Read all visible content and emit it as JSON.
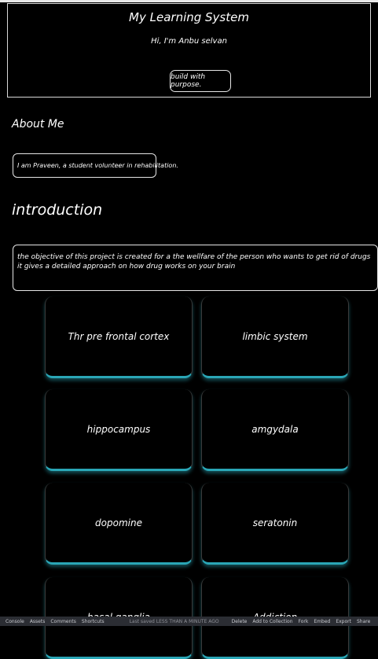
{
  "header": {
    "title": "My Learning System",
    "greeting": "Hi, I'm Anbu selvan",
    "tagline": "build with purpose."
  },
  "about": {
    "heading": "About Me",
    "text": "I am Praveen, a student volunteer in rehabilitation."
  },
  "introduction": {
    "heading": "introduction",
    "text": "the objective of this project is created for a the wellfare of the person who wants to get rid of drugs it gives a detailed approach on how drug works on your brain"
  },
  "cards": [
    {
      "label": "Thr pre frontal cortex"
    },
    {
      "label": "limbic system"
    },
    {
      "label": "hippocampus"
    },
    {
      "label": "amgydala"
    },
    {
      "label": "dopomine"
    },
    {
      "label": "seratonin"
    },
    {
      "label": "basal ganglia"
    },
    {
      "label": "Addiction"
    }
  ],
  "toolbar": {
    "console": "Console",
    "assets": "Assets",
    "comments": "Comments",
    "shortcuts": "Shortcuts",
    "status": "Last saved LESS THAN A MINUTE AGO",
    "delete": "Delete",
    "add_to_collection": "Add to Collection",
    "fork": "Fork",
    "embed": "Embed",
    "export": "Export",
    "share": "Share"
  }
}
